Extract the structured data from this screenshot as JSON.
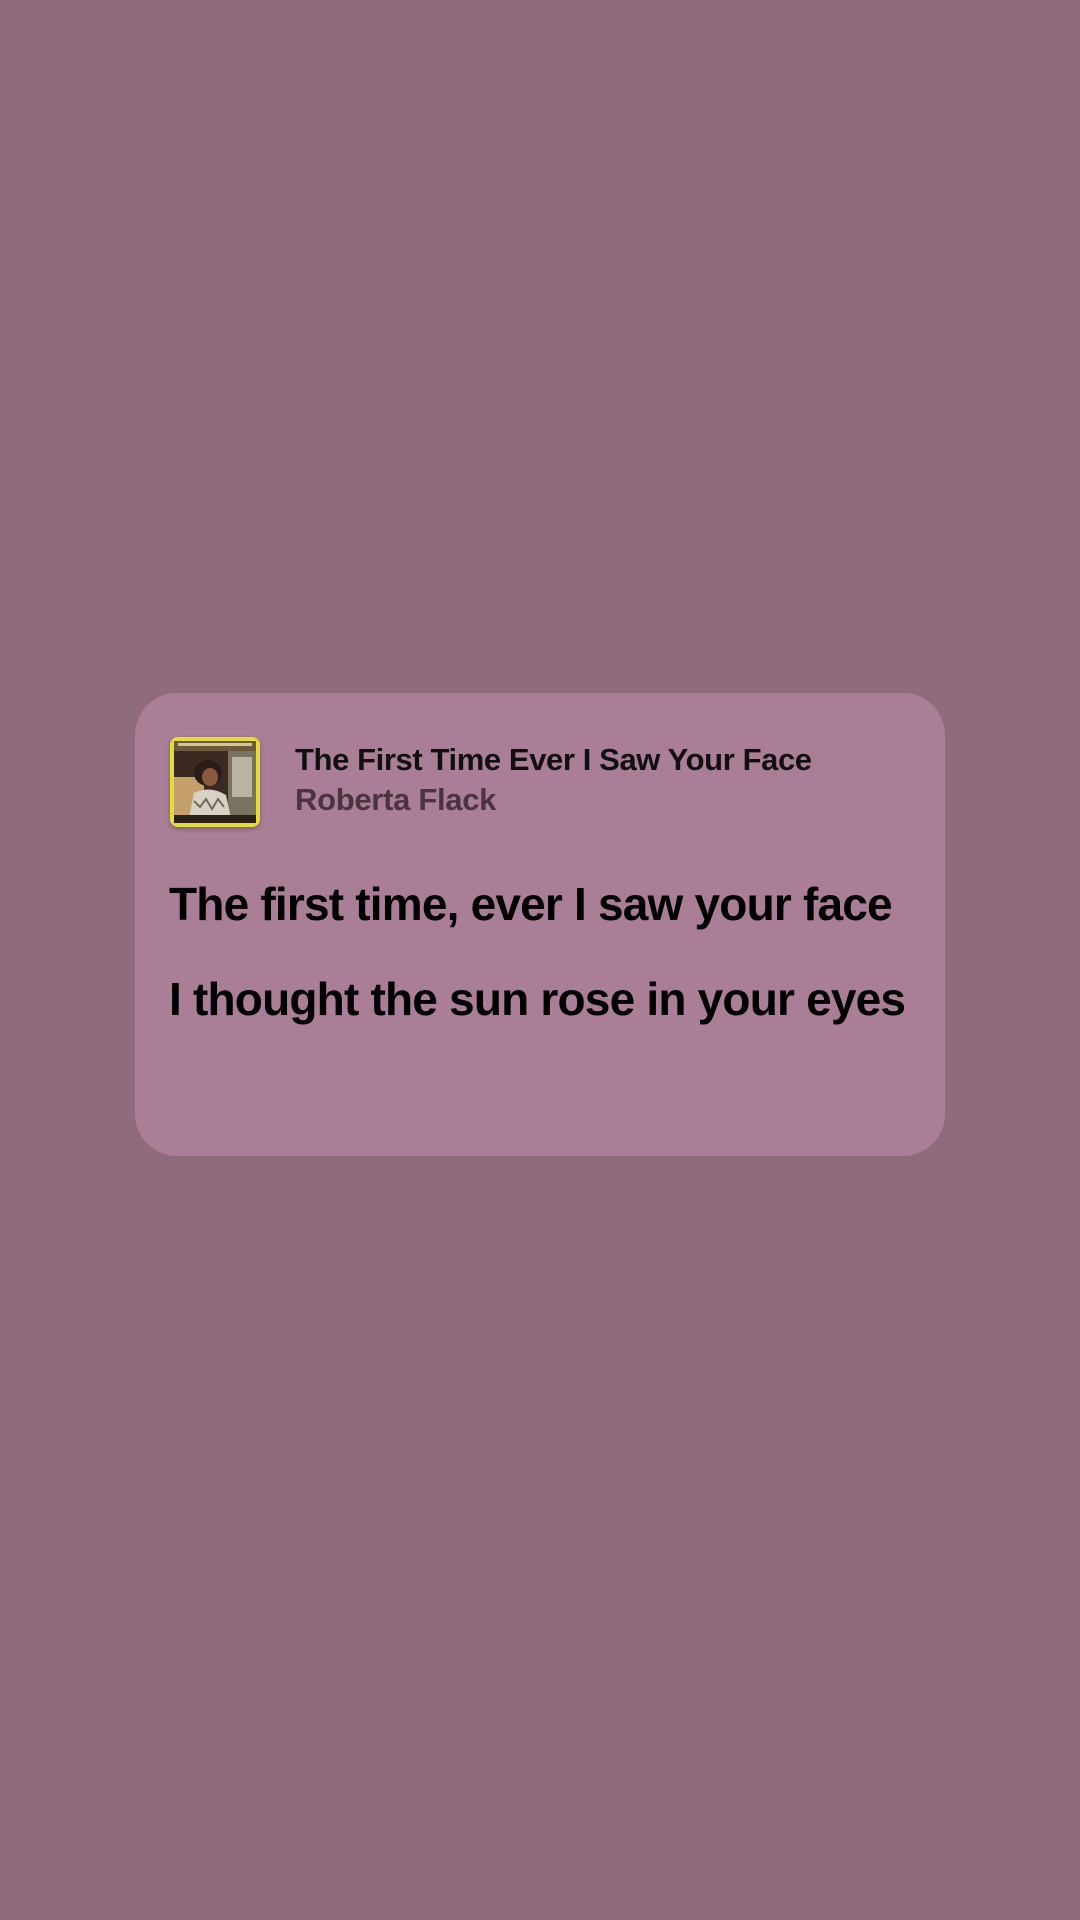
{
  "colors": {
    "background": "#8f6c7b",
    "card": "#a97e96",
    "title_text": "#101010",
    "artist_text": "#4b3442",
    "lyric_text": "#000000"
  },
  "track": {
    "title": "The First Time Ever I Saw Your Face",
    "artist": "Roberta Flack",
    "album_art_icon": "album-cover-image"
  },
  "lyrics": [
    "The first time, ever I saw your face",
    "I thought the sun rose in your eyes"
  ]
}
